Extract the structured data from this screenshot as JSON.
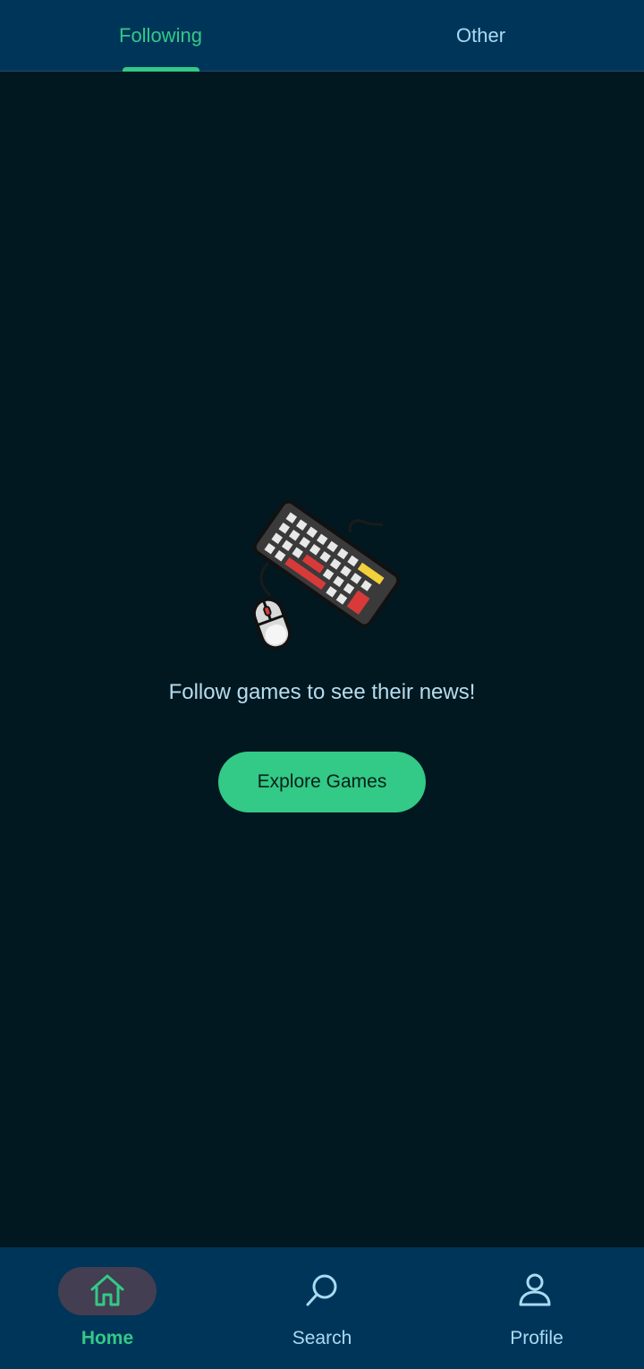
{
  "tabs": [
    {
      "label": "Following",
      "active": true
    },
    {
      "label": "Other",
      "active": false
    }
  ],
  "empty_state": {
    "illustration": "keyboard-mouse-icon",
    "message": "Follow games to see their news!",
    "button_label": "Explore Games"
  },
  "bottom_nav": {
    "items": [
      {
        "label": "Home",
        "icon": "home-icon",
        "active": true
      },
      {
        "label": "Search",
        "icon": "search-icon",
        "active": false
      },
      {
        "label": "Profile",
        "icon": "profile-icon",
        "active": false
      }
    ]
  },
  "colors": {
    "background": "#011820",
    "bar": "#00355a",
    "accent": "#33c987",
    "inactive_text": "#a9dbf2",
    "active_pill": "#433e51"
  }
}
